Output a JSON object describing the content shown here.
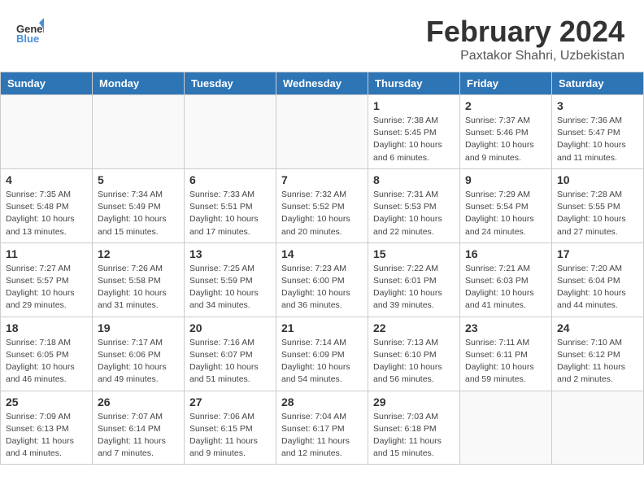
{
  "header": {
    "logo_text_general": "General",
    "logo_text_blue": "Blue",
    "month": "February 2024",
    "location": "Paxtakor Shahri, Uzbekistan"
  },
  "weekdays": [
    "Sunday",
    "Monday",
    "Tuesday",
    "Wednesday",
    "Thursday",
    "Friday",
    "Saturday"
  ],
  "weeks": [
    [
      {
        "day": "",
        "info": "",
        "empty": true
      },
      {
        "day": "",
        "info": "",
        "empty": true
      },
      {
        "day": "",
        "info": "",
        "empty": true
      },
      {
        "day": "",
        "info": "",
        "empty": true
      },
      {
        "day": "1",
        "info": "Sunrise: 7:38 AM\nSunset: 5:45 PM\nDaylight: 10 hours and 6 minutes.",
        "empty": false
      },
      {
        "day": "2",
        "info": "Sunrise: 7:37 AM\nSunset: 5:46 PM\nDaylight: 10 hours and 9 minutes.",
        "empty": false
      },
      {
        "day": "3",
        "info": "Sunrise: 7:36 AM\nSunset: 5:47 PM\nDaylight: 10 hours and 11 minutes.",
        "empty": false
      }
    ],
    [
      {
        "day": "4",
        "info": "Sunrise: 7:35 AM\nSunset: 5:48 PM\nDaylight: 10 hours and 13 minutes.",
        "empty": false
      },
      {
        "day": "5",
        "info": "Sunrise: 7:34 AM\nSunset: 5:49 PM\nDaylight: 10 hours and 15 minutes.",
        "empty": false
      },
      {
        "day": "6",
        "info": "Sunrise: 7:33 AM\nSunset: 5:51 PM\nDaylight: 10 hours and 17 minutes.",
        "empty": false
      },
      {
        "day": "7",
        "info": "Sunrise: 7:32 AM\nSunset: 5:52 PM\nDaylight: 10 hours and 20 minutes.",
        "empty": false
      },
      {
        "day": "8",
        "info": "Sunrise: 7:31 AM\nSunset: 5:53 PM\nDaylight: 10 hours and 22 minutes.",
        "empty": false
      },
      {
        "day": "9",
        "info": "Sunrise: 7:29 AM\nSunset: 5:54 PM\nDaylight: 10 hours and 24 minutes.",
        "empty": false
      },
      {
        "day": "10",
        "info": "Sunrise: 7:28 AM\nSunset: 5:55 PM\nDaylight: 10 hours and 27 minutes.",
        "empty": false
      }
    ],
    [
      {
        "day": "11",
        "info": "Sunrise: 7:27 AM\nSunset: 5:57 PM\nDaylight: 10 hours and 29 minutes.",
        "empty": false
      },
      {
        "day": "12",
        "info": "Sunrise: 7:26 AM\nSunset: 5:58 PM\nDaylight: 10 hours and 31 minutes.",
        "empty": false
      },
      {
        "day": "13",
        "info": "Sunrise: 7:25 AM\nSunset: 5:59 PM\nDaylight: 10 hours and 34 minutes.",
        "empty": false
      },
      {
        "day": "14",
        "info": "Sunrise: 7:23 AM\nSunset: 6:00 PM\nDaylight: 10 hours and 36 minutes.",
        "empty": false
      },
      {
        "day": "15",
        "info": "Sunrise: 7:22 AM\nSunset: 6:01 PM\nDaylight: 10 hours and 39 minutes.",
        "empty": false
      },
      {
        "day": "16",
        "info": "Sunrise: 7:21 AM\nSunset: 6:03 PM\nDaylight: 10 hours and 41 minutes.",
        "empty": false
      },
      {
        "day": "17",
        "info": "Sunrise: 7:20 AM\nSunset: 6:04 PM\nDaylight: 10 hours and 44 minutes.",
        "empty": false
      }
    ],
    [
      {
        "day": "18",
        "info": "Sunrise: 7:18 AM\nSunset: 6:05 PM\nDaylight: 10 hours and 46 minutes.",
        "empty": false
      },
      {
        "day": "19",
        "info": "Sunrise: 7:17 AM\nSunset: 6:06 PM\nDaylight: 10 hours and 49 minutes.",
        "empty": false
      },
      {
        "day": "20",
        "info": "Sunrise: 7:16 AM\nSunset: 6:07 PM\nDaylight: 10 hours and 51 minutes.",
        "empty": false
      },
      {
        "day": "21",
        "info": "Sunrise: 7:14 AM\nSunset: 6:09 PM\nDaylight: 10 hours and 54 minutes.",
        "empty": false
      },
      {
        "day": "22",
        "info": "Sunrise: 7:13 AM\nSunset: 6:10 PM\nDaylight: 10 hours and 56 minutes.",
        "empty": false
      },
      {
        "day": "23",
        "info": "Sunrise: 7:11 AM\nSunset: 6:11 PM\nDaylight: 10 hours and 59 minutes.",
        "empty": false
      },
      {
        "day": "24",
        "info": "Sunrise: 7:10 AM\nSunset: 6:12 PM\nDaylight: 11 hours and 2 minutes.",
        "empty": false
      }
    ],
    [
      {
        "day": "25",
        "info": "Sunrise: 7:09 AM\nSunset: 6:13 PM\nDaylight: 11 hours and 4 minutes.",
        "empty": false
      },
      {
        "day": "26",
        "info": "Sunrise: 7:07 AM\nSunset: 6:14 PM\nDaylight: 11 hours and 7 minutes.",
        "empty": false
      },
      {
        "day": "27",
        "info": "Sunrise: 7:06 AM\nSunset: 6:15 PM\nDaylight: 11 hours and 9 minutes.",
        "empty": false
      },
      {
        "day": "28",
        "info": "Sunrise: 7:04 AM\nSunset: 6:17 PM\nDaylight: 11 hours and 12 minutes.",
        "empty": false
      },
      {
        "day": "29",
        "info": "Sunrise: 7:03 AM\nSunset: 6:18 PM\nDaylight: 11 hours and 15 minutes.",
        "empty": false
      },
      {
        "day": "",
        "info": "",
        "empty": true
      },
      {
        "day": "",
        "info": "",
        "empty": true
      }
    ]
  ]
}
